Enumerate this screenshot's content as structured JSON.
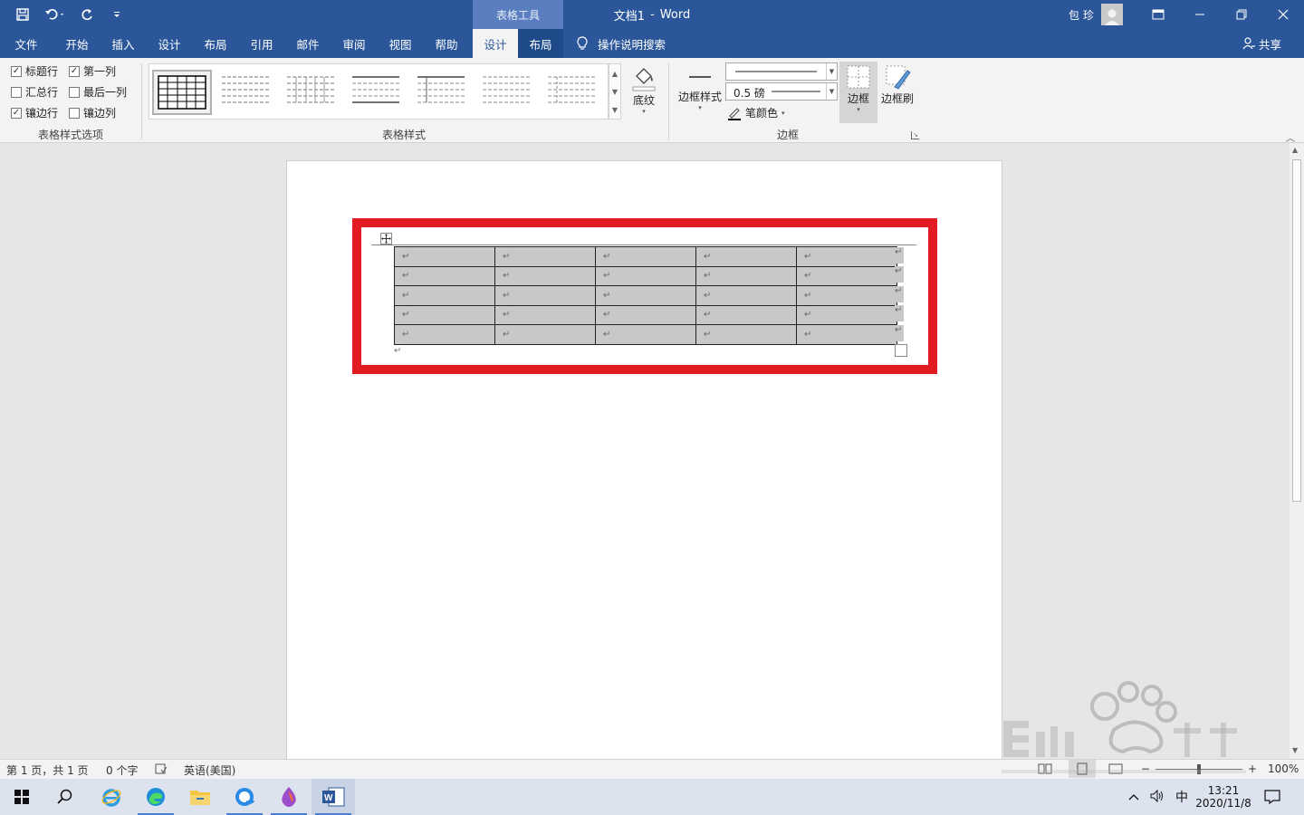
{
  "titlebar": {
    "context_tab_group": "表格工具",
    "doc_name": "文档1",
    "separator": "-",
    "app_name": "Word",
    "user_name": "包 珍"
  },
  "tabs": {
    "file": "文件",
    "home": "开始",
    "insert": "插入",
    "design": "设计",
    "layout": "布局",
    "references": "引用",
    "mailings": "邮件",
    "review": "审阅",
    "view": "视图",
    "help": "帮助",
    "table_design": "设计",
    "table_layout": "布局",
    "tell_me": "操作说明搜索",
    "share": "共享"
  },
  "ribbon": {
    "style_options": {
      "header_row": {
        "label": "标题行",
        "checked": true
      },
      "first_column": {
        "label": "第一列",
        "checked": true
      },
      "total_row": {
        "label": "汇总行",
        "checked": false
      },
      "last_column": {
        "label": "最后一列",
        "checked": false
      },
      "banded_rows": {
        "label": "镶边行",
        "checked": true
      },
      "banded_columns": {
        "label": "镶边列",
        "checked": false
      },
      "group_label": "表格样式选项"
    },
    "table_styles": {
      "group_label": "表格样式",
      "shading_label": "底纹"
    },
    "borders": {
      "border_styles_label": "边框样式",
      "pen_weight": "0.5 磅",
      "pen_color_label": "笔颜色",
      "borders_label": "边框",
      "border_painter_label": "边框刷",
      "group_label": "边框"
    }
  },
  "document": {
    "table": {
      "rows": 5,
      "columns": 5,
      "cell_mark": "↵",
      "shading_color": "#c8c8c8"
    },
    "highlight_color": "#e31b23"
  },
  "statusbar": {
    "page_info": "第 1 页，共 1 页",
    "word_count": "0 个字",
    "language": "英语(美国)",
    "zoom": "100%"
  },
  "taskbar": {
    "ime": "中",
    "time": "13:21",
    "date": "2020/11/8"
  },
  "colors": {
    "accent": "#2b579a",
    "highlight": "#e31b23"
  }
}
